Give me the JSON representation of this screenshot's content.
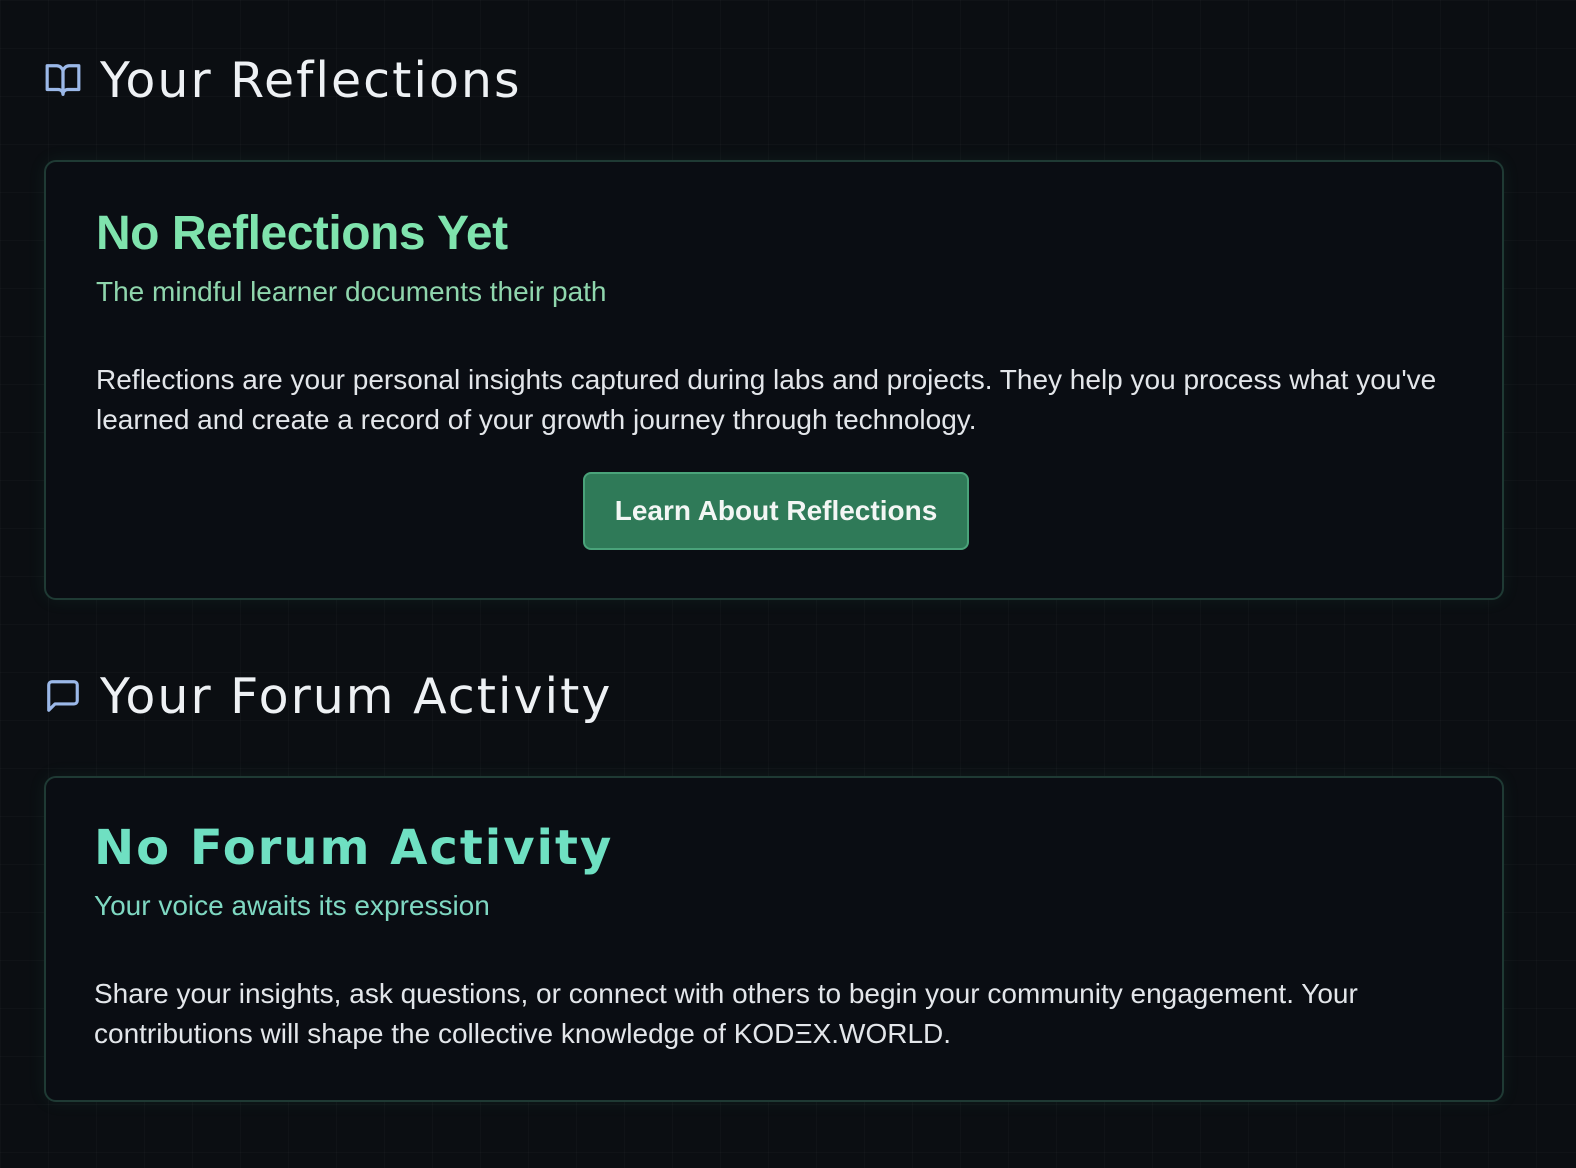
{
  "reflections": {
    "heading": "Your Reflections",
    "icon": "book-open-icon",
    "empty_state": {
      "title": "No Reflections Yet",
      "subtitle": "The mindful learner documents their path",
      "body": "Reflections are your personal insights captured during labs and projects. They help you process what you've learned and create a record of your growth journey through technology.",
      "button_label": "Learn About Reflections"
    }
  },
  "forum": {
    "heading": "Your Forum Activity",
    "icon": "message-square-icon",
    "empty_state": {
      "title": "No Forum Activity",
      "subtitle": "Your voice awaits its expression",
      "body": "Share your insights, ask questions, or connect with others to begin your community engagement. Your contributions will shape the collective knowledge of KODΞX.WORLD."
    }
  },
  "colors": {
    "background": "#0b0e12",
    "accent": "#7fe3ad",
    "button": "#2f7a58",
    "icon": "#9bb8e8"
  }
}
